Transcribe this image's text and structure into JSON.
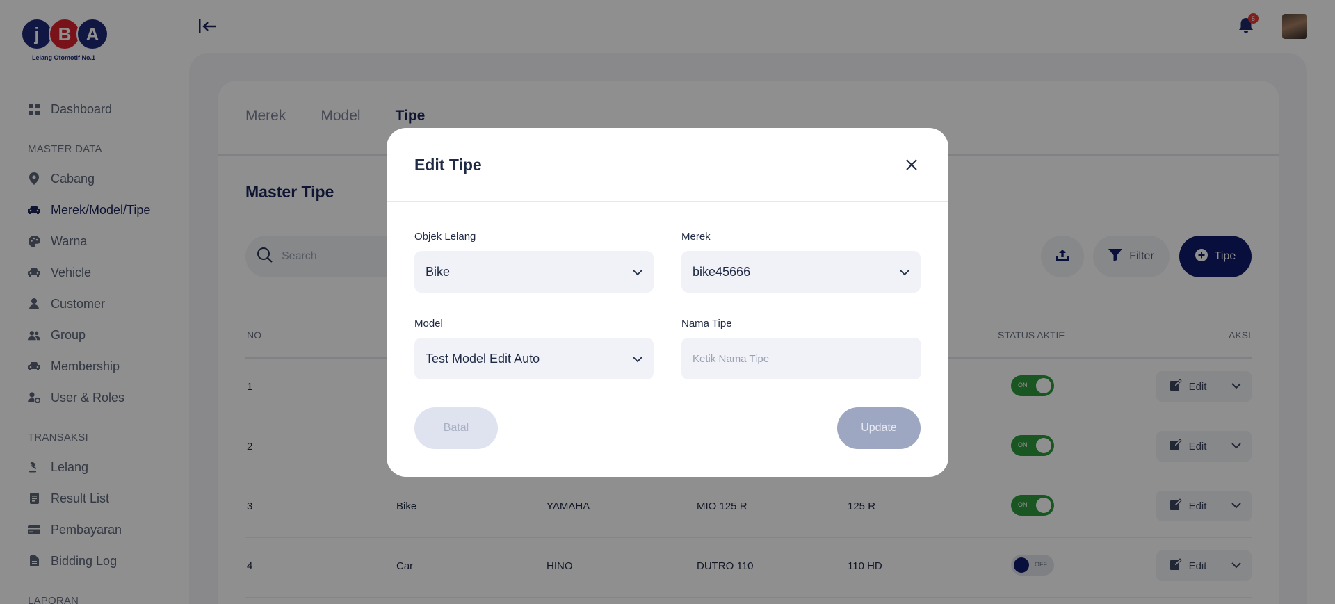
{
  "brand": {
    "logo_letters": [
      "j",
      "B",
      "A"
    ],
    "tagline": "Lelang Otomotif No.1"
  },
  "sidebar": {
    "items_top": [
      {
        "label": "Dashboard",
        "icon": "grid-icon"
      }
    ],
    "section_master": "MASTER DATA",
    "items_master": [
      {
        "label": "Cabang",
        "icon": "map-pin-icon"
      },
      {
        "label": "Merek/Model/Tipe",
        "icon": "car-icon",
        "active": true
      },
      {
        "label": "Warna",
        "icon": "palette-icon"
      },
      {
        "label": "Vehicle",
        "icon": "car-icon"
      },
      {
        "label": "Customer",
        "icon": "user-icon"
      },
      {
        "label": "Group",
        "icon": "users-icon"
      },
      {
        "label": "Membership",
        "icon": "car-icon"
      },
      {
        "label": "User & Roles",
        "icon": "user-cog-icon"
      }
    ],
    "section_transaksi": "TRANSAKSI",
    "items_transaksi": [
      {
        "label": "Lelang",
        "icon": "gavel-icon"
      },
      {
        "label": "Result List",
        "icon": "list-icon"
      },
      {
        "label": "Pembayaran",
        "icon": "credit-card-icon"
      },
      {
        "label": "Bidding Log",
        "icon": "document-icon"
      }
    ],
    "section_laporan": "LAPORAN"
  },
  "header": {
    "notification_count": "5"
  },
  "tabs": [
    {
      "label": "Merek",
      "active": false
    },
    {
      "label": "Model",
      "active": false
    },
    {
      "label": "Tipe",
      "active": true
    }
  ],
  "page": {
    "title": "Master Tipe",
    "search_placeholder": "Search",
    "filter_label": "Filter",
    "add_label": "Tipe"
  },
  "table": {
    "headers": [
      "NO",
      "STATUS AKTIF",
      "AKSI"
    ],
    "edit_label": "Edit",
    "rows": [
      {
        "no": "1",
        "objek": "",
        "merek": "",
        "model": "",
        "tipe": "",
        "status": "ON"
      },
      {
        "no": "2",
        "objek": "",
        "merek": "",
        "model": "",
        "tipe": "",
        "status": "ON"
      },
      {
        "no": "3",
        "objek": "Bike",
        "merek": "YAMAHA",
        "model": "MIO 125 R",
        "tipe": "125 R",
        "status": "ON"
      },
      {
        "no": "4",
        "objek": "Car",
        "merek": "HINO",
        "model": "DUTRO 110",
        "tipe": "110 HD",
        "status": "OFF"
      }
    ]
  },
  "modal": {
    "title": "Edit Tipe",
    "objek_label": "Objek Lelang",
    "objek_value": "Bike",
    "merek_label": "Merek",
    "merek_value": "bike45666",
    "model_label": "Model",
    "model_value": "Test Model Edit Auto",
    "nama_tipe_label": "Nama Tipe",
    "nama_tipe_placeholder": "Ketik Nama Tipe",
    "cancel_label": "Batal",
    "update_label": "Update"
  },
  "colors": {
    "primary": "#0f1b6b",
    "toggle_on": "#2e9a3e",
    "badge": "#e53935"
  }
}
